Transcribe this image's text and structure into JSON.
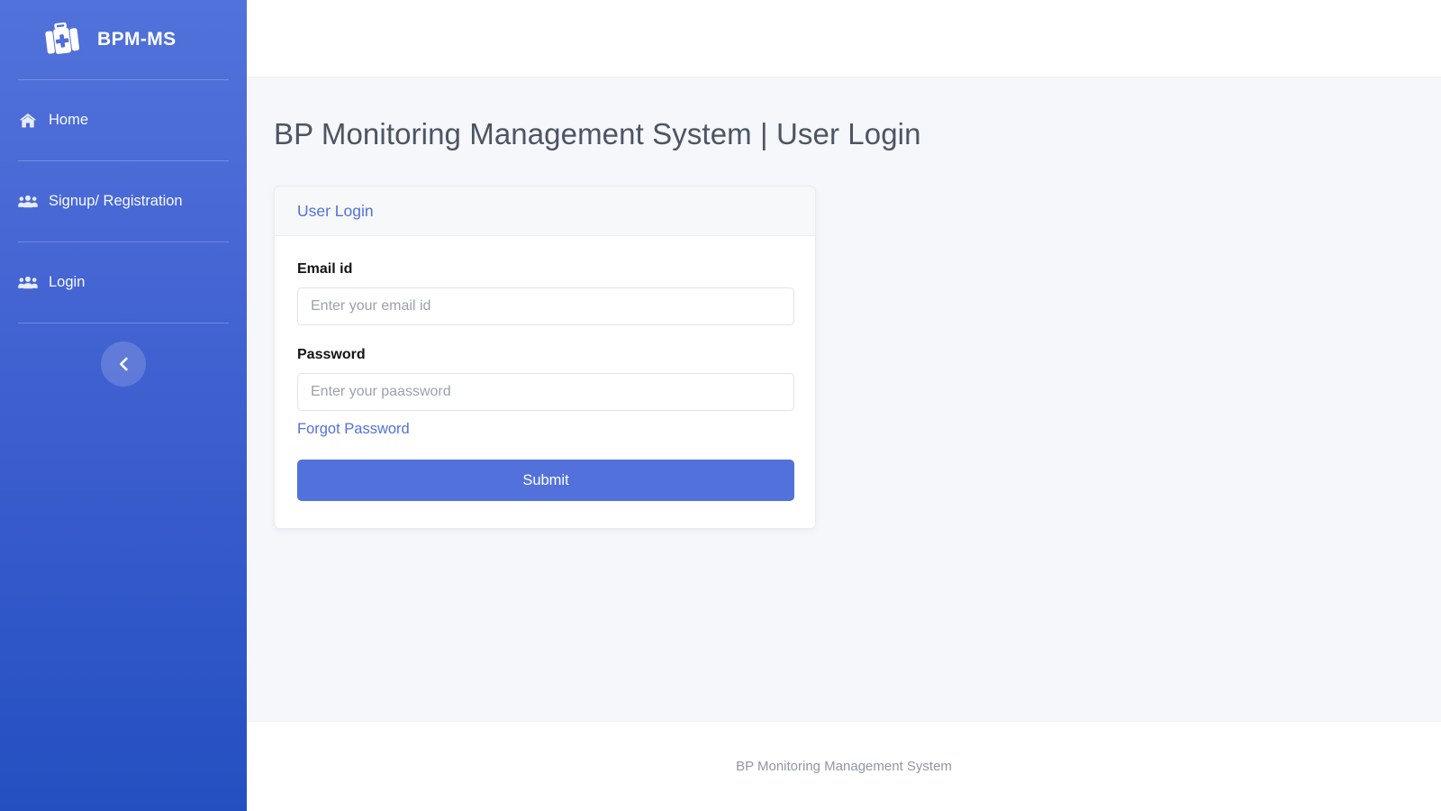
{
  "sidebar": {
    "brand": {
      "name": "BPM-MS",
      "logo_icon": "medical-briefcase-icon"
    },
    "items": [
      {
        "label": "Home",
        "icon": "home-icon"
      },
      {
        "label": "Signup/ Registration",
        "icon": "users-group-icon"
      },
      {
        "label": "Login",
        "icon": "users-group-icon"
      }
    ],
    "collapse_button": {
      "icon": "chevron-left-icon"
    },
    "colors": {
      "gradient_top": "#5172da",
      "gradient_bottom": "#2350c1"
    }
  },
  "main": {
    "page_title": "BP Monitoring Management System | User Login",
    "card": {
      "header_title": "User Login",
      "fields": [
        {
          "label": "Email id",
          "placeholder": "Enter your email id",
          "value": "",
          "type": "email"
        },
        {
          "label": "Password",
          "placeholder": "Enter your paassword",
          "value": "",
          "type": "password"
        }
      ],
      "forgot_link": "Forgot Password",
      "submit_label": "Submit"
    }
  },
  "footer": {
    "text": "BP Monitoring Management System"
  },
  "theme": {
    "accent": "#5271db",
    "content_bg": "#f6f7fb",
    "text_muted": "#9096a3"
  }
}
